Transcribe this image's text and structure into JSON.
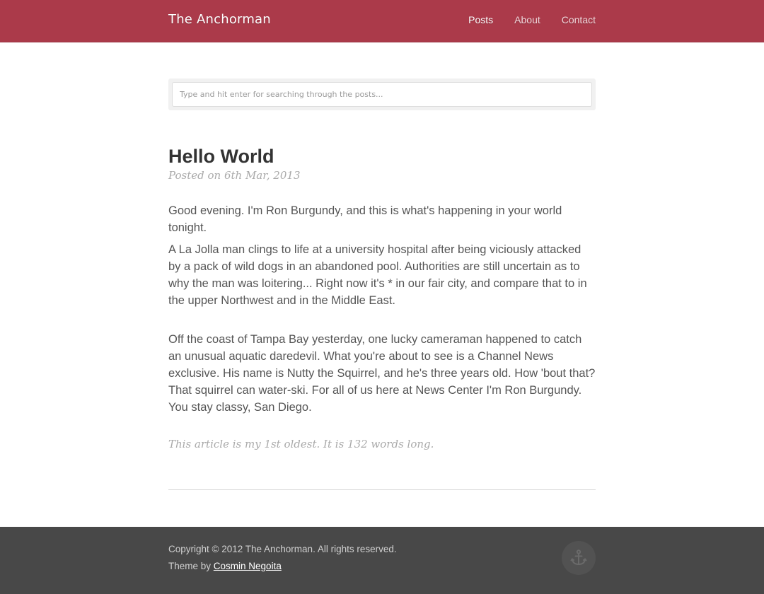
{
  "header": {
    "brand": "The Anchorman",
    "nav": [
      {
        "label": "Posts"
      },
      {
        "label": "About"
      },
      {
        "label": "Contact"
      }
    ]
  },
  "search": {
    "placeholder": "Type and hit enter for searching through the posts..."
  },
  "post": {
    "title": "Hello World",
    "meta": "Posted on 6th Mar, 2013",
    "paragraphs": [
      "Good evening. I'm Ron Burgundy, and this is what's happening in your world tonight.",
      "A La Jolla man clings to life at a university hospital after being viciously attacked by a pack of wild dogs in an abandoned pool. Authorities are still uncertain as to why the man was loitering... Right now it's * in our fair city, and compare that to in the upper Northwest and in the Middle East.",
      "Off the coast of Tampa Bay yesterday, one lucky cameraman happened to catch an unusual aquatic daredevil. What you're about to see is a Channel News exclusive. His name is Nutty the Squirrel, and he's three years old. How 'bout that? That squirrel can water-ski. For all of us here at News Center I'm Ron Burgundy. You stay classy, San Diego."
    ],
    "note": "This article is my 1st oldest. It is 132 words long."
  },
  "footer": {
    "copyright": "Copyright © 2012 The Anchorman. All rights reserved.",
    "credit_prefix": "Theme by ",
    "credit_link": "Cosmin Negoita",
    "anchor_icon": "anchor-icon"
  },
  "colors": {
    "header_bg": "#ab3a4a",
    "footer_bg": "#484848",
    "text": "#555555",
    "muted": "#aaaaaa"
  }
}
